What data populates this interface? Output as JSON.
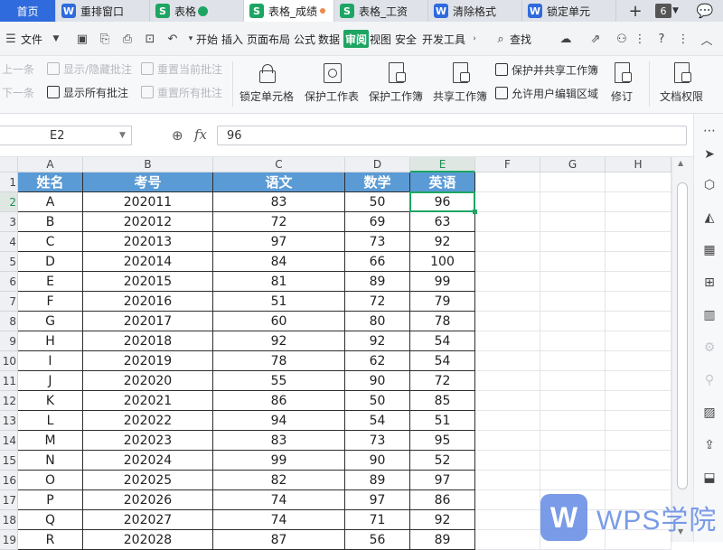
{
  "tabs": [
    {
      "label": "首页",
      "type": "home"
    },
    {
      "label": "重排窗口",
      "type": "w"
    },
    {
      "label": "表格",
      "type": "s",
      "check": true
    },
    {
      "label": "表格_成绩",
      "type": "s",
      "active": true,
      "dot": true
    },
    {
      "label": "表格_工资",
      "type": "s"
    },
    {
      "label": "清除格式",
      "type": "w"
    },
    {
      "label": "锁定单元",
      "type": "w"
    }
  ],
  "tab_icons": {
    "w": "W",
    "s": "S"
  },
  "tabbar": {
    "add": "+",
    "count": "6",
    "chat_icon": "💬"
  },
  "menu": {
    "file": "文件",
    "items": [
      "开始",
      "插入",
      "页面布局",
      "公式",
      "数据",
      "审阅",
      "视图",
      "安全",
      "开发工具"
    ],
    "selected": "审阅",
    "search": "查找"
  },
  "ribbon": {
    "small_left": [
      {
        "label": "上一条",
        "disabled": true
      },
      {
        "label": "下一条",
        "disabled": true
      },
      {
        "label": "显示/隐藏批注",
        "disabled": true
      },
      {
        "label": "显示所有批注",
        "disabled": false
      },
      {
        "label": "重置当前批注",
        "disabled": true
      },
      {
        "label": "重置所有批注",
        "disabled": true
      }
    ],
    "big": [
      "锁定单元格",
      "保护工作表",
      "保护工作簿",
      "共享工作簿"
    ],
    "small_right": [
      "保护并共享工作簿",
      "允许用户编辑区域"
    ],
    "revise": "修订",
    "doc_rights": "文档权限"
  },
  "formula_bar": {
    "cell_ref": "E2",
    "fx": "fx",
    "value": "96"
  },
  "grid": {
    "columns": [
      "A",
      "B",
      "C",
      "D",
      "E",
      "F",
      "G",
      "H"
    ],
    "active_column": "E",
    "active_row": 2,
    "headers": [
      "姓名",
      "考号",
      "语文",
      "数学",
      "英语"
    ],
    "rows": [
      [
        "A",
        "202011",
        "83",
        "50",
        "96"
      ],
      [
        "B",
        "202012",
        "72",
        "69",
        "63"
      ],
      [
        "C",
        "202013",
        "97",
        "73",
        "92"
      ],
      [
        "D",
        "202014",
        "84",
        "66",
        "100"
      ],
      [
        "E",
        "202015",
        "81",
        "89",
        "99"
      ],
      [
        "F",
        "202016",
        "51",
        "72",
        "79"
      ],
      [
        "G",
        "202017",
        "60",
        "80",
        "78"
      ],
      [
        "H",
        "202018",
        "92",
        "92",
        "54"
      ],
      [
        "I",
        "202019",
        "78",
        "62",
        "54"
      ],
      [
        "J",
        "202020",
        "55",
        "90",
        "72"
      ],
      [
        "K",
        "202021",
        "86",
        "50",
        "85"
      ],
      [
        "L",
        "202022",
        "94",
        "54",
        "51"
      ],
      [
        "M",
        "202023",
        "83",
        "73",
        "95"
      ],
      [
        "N",
        "202024",
        "99",
        "90",
        "52"
      ],
      [
        "O",
        "202025",
        "82",
        "89",
        "97"
      ],
      [
        "P",
        "202026",
        "74",
        "97",
        "86"
      ],
      [
        "Q",
        "202027",
        "74",
        "71",
        "92"
      ],
      [
        "R",
        "202028",
        "87",
        "56",
        "89"
      ]
    ]
  },
  "watermark": {
    "logo": "W",
    "text": "WPS学院"
  },
  "colors": {
    "header_fill": "#5b9bd5",
    "accent": "#1ea563",
    "home_tab": "#2f6bdc"
  }
}
